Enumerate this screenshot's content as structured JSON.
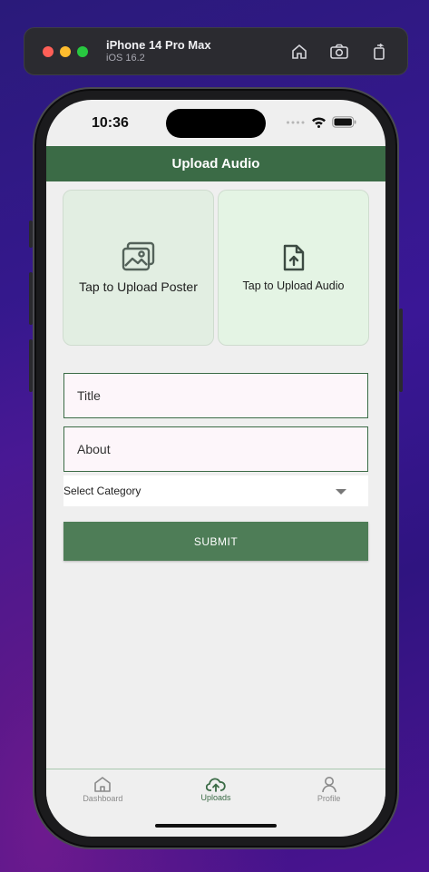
{
  "simulator": {
    "device": "iPhone 14 Pro Max",
    "os": "iOS 16.2",
    "lights": [
      "#ff5f57",
      "#febc2e",
      "#28c840"
    ],
    "actions": [
      "home-icon",
      "screenshot-icon",
      "rotate-icon"
    ]
  },
  "status": {
    "time": "10:36"
  },
  "header": {
    "title": "Upload Audio"
  },
  "uploads": {
    "poster_label": "Tap to Upload Poster",
    "audio_label": "Tap to Upload Audio"
  },
  "form": {
    "title_placeholder": "Title",
    "about_placeholder": "About",
    "category_placeholder": "Select Category",
    "submit_label": "SUBMIT"
  },
  "tabs": [
    {
      "label": "Dashboard",
      "icon": "home-icon",
      "active": false
    },
    {
      "label": "Uploads",
      "icon": "cloud-upload-icon",
      "active": true
    },
    {
      "label": "Profile",
      "icon": "person-icon",
      "active": false
    }
  ],
  "colors": {
    "brand": "#3b6b46",
    "button": "#4e7d57"
  }
}
